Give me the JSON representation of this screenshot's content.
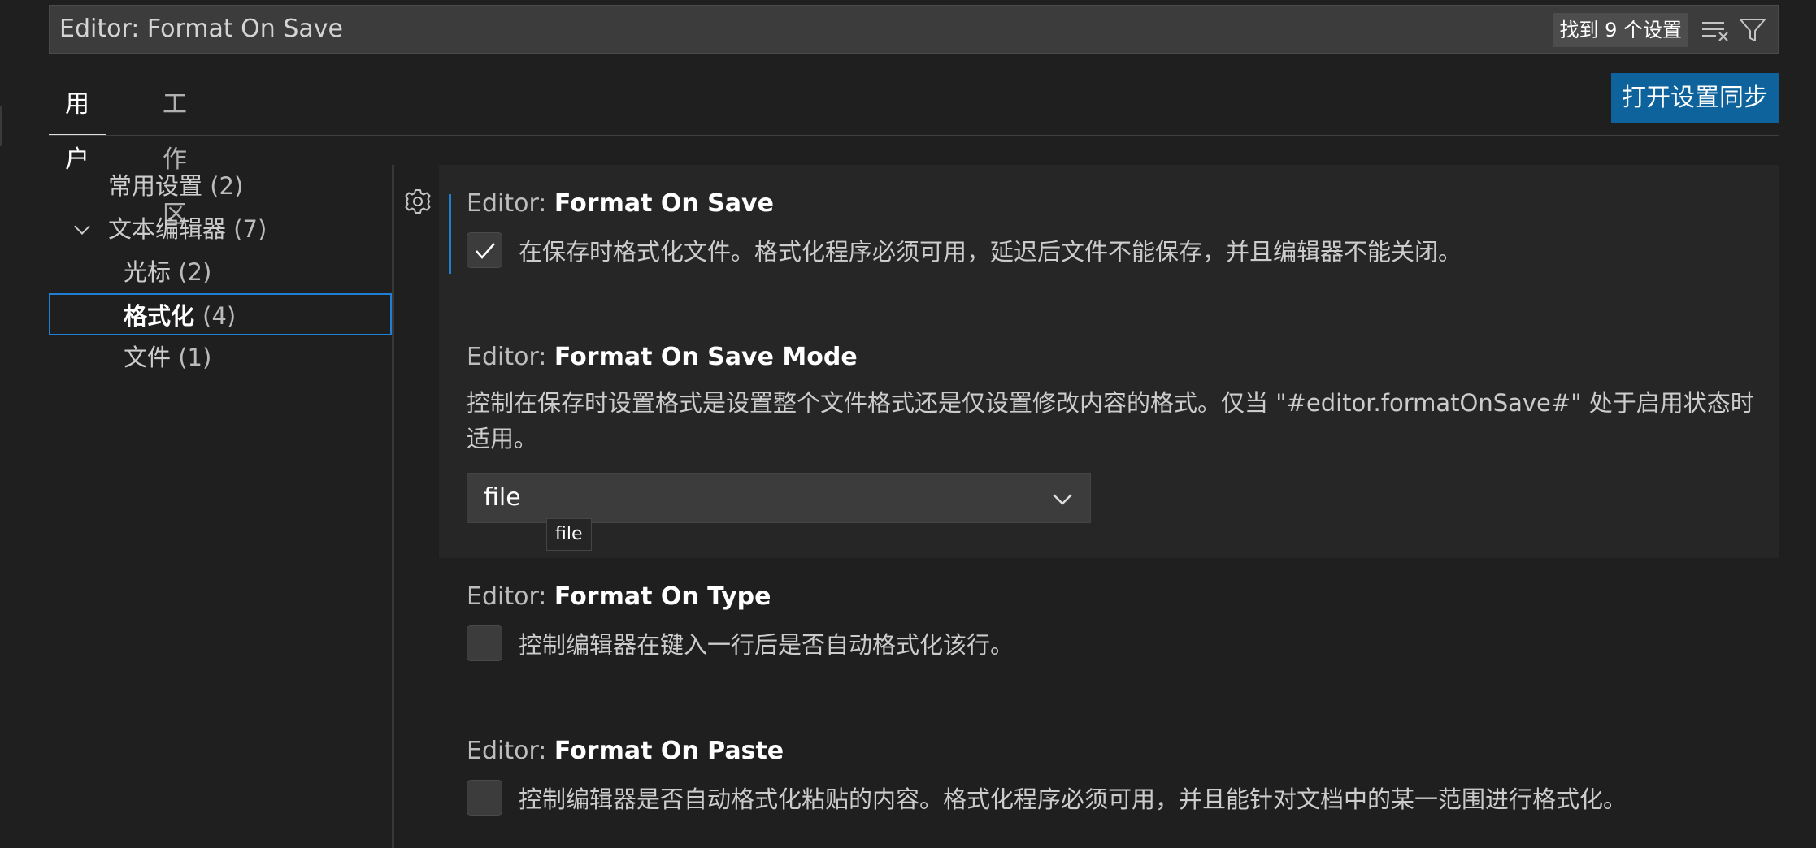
{
  "search": {
    "value": "Editor: Format On Save",
    "results_badge": "找到 9 个设置"
  },
  "tabs": [
    {
      "label": "用户",
      "active": true
    },
    {
      "label": "工作区",
      "active": false
    }
  ],
  "sync_button": "打开设置同步",
  "toc": [
    {
      "label": "常用设置",
      "count": "(2)"
    },
    {
      "label": "文本编辑器",
      "count": "(7)",
      "expanded": true
    },
    {
      "label": "光标",
      "count": "(2)"
    },
    {
      "label": "格式化",
      "count": "(4)",
      "selected": true
    },
    {
      "label": "文件",
      "count": "(1)"
    }
  ],
  "settings": [
    {
      "category": "Editor: ",
      "name": "Format On Save",
      "description": "在保存时格式化文件。格式化程序必须可用，延迟后文件不能保存，并且编辑器不能关闭。",
      "checked": true
    },
    {
      "category": "Editor: ",
      "name": "Format On Save Mode",
      "description": "控制在保存时设置格式是设置整个文件格式还是仅设置修改内容的格式。仅当 \"#editor.formatOnSave#\" 处于启用状态时适用。",
      "select_value": "file",
      "tooltip": "file"
    },
    {
      "category": "Editor: ",
      "name": "Format On Type",
      "description": "控制编辑器在键入一行后是否自动格式化该行。",
      "checked": false
    },
    {
      "category": "Editor: ",
      "name": "Format On Paste",
      "description": "控制编辑器是否自动格式化粘贴的内容。格式化程序必须可用，并且能针对文档中的某一范围进行格式化。",
      "checked": false
    }
  ],
  "icons": {
    "clear": "clear-filter-icon",
    "filter": "filter-icon",
    "gear": "gear-icon",
    "check": "check-icon",
    "chevron": "chevron-down-icon"
  },
  "colors": {
    "accent": "#0e639c",
    "focus": "#1e7fd4",
    "background": "#1f1f1f"
  }
}
